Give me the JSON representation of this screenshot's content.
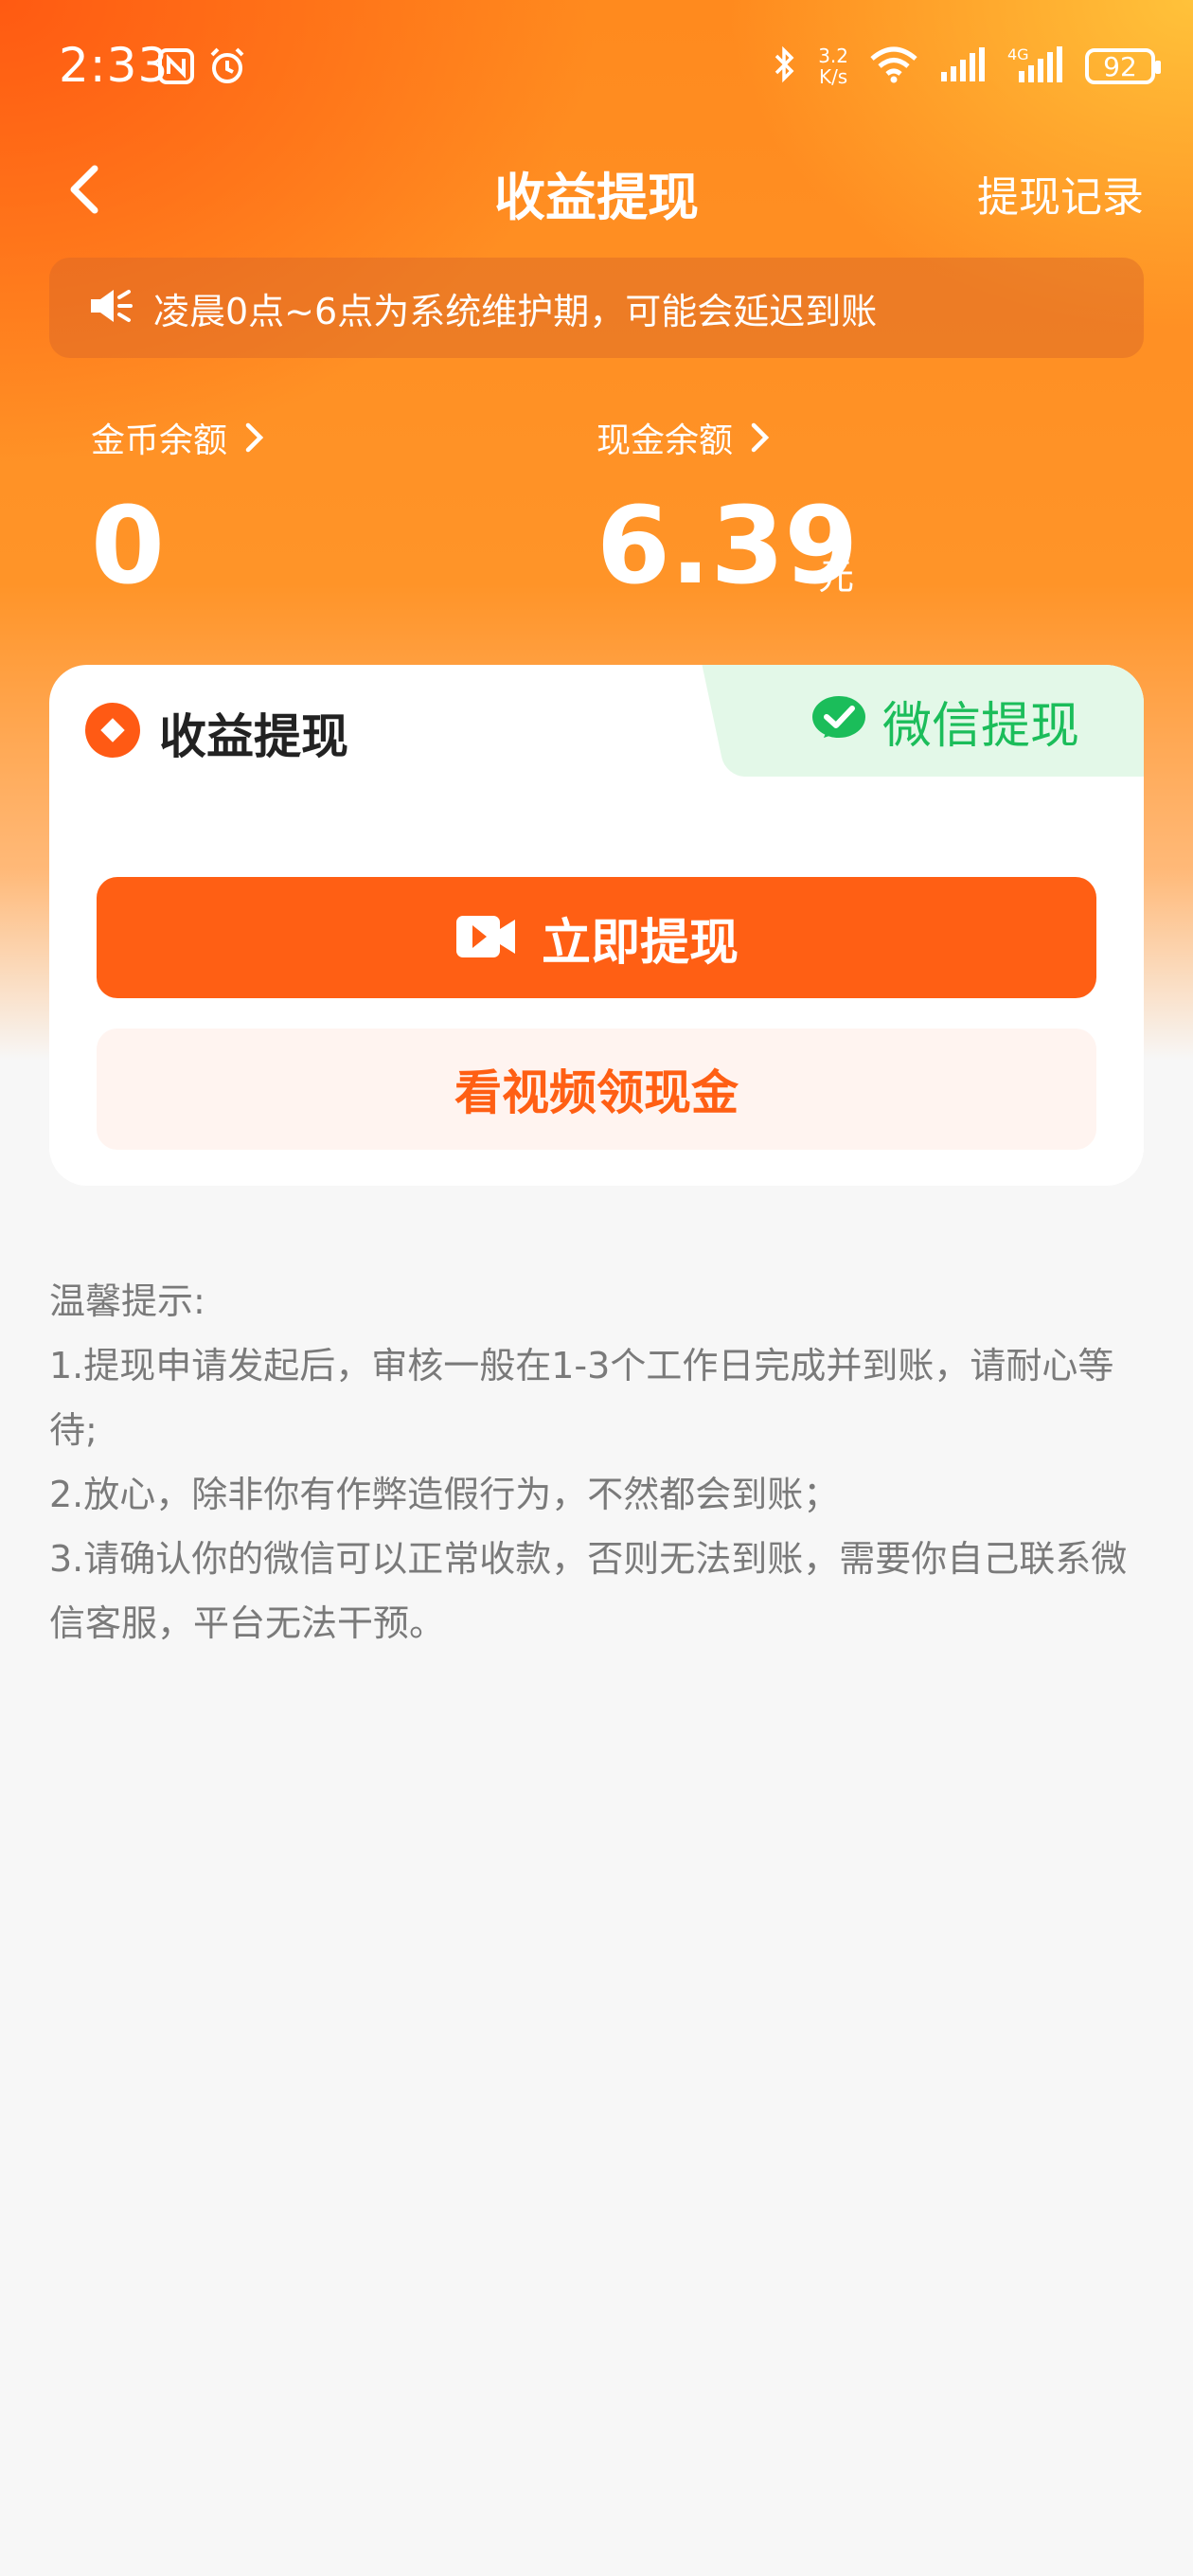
{
  "status_bar": {
    "time": "2:33",
    "net_speed_top": "3.2",
    "net_speed_bottom": "K/s",
    "battery": "92",
    "icons": [
      "nfc-icon",
      "alarm-icon",
      "bluetooth-icon",
      "wifi-icon",
      "signal-icon",
      "signal-4g-icon",
      "battery-icon"
    ]
  },
  "header": {
    "title": "收益提现",
    "right_link": "提现记录"
  },
  "notice": {
    "text": "凌晨0点~6点为系统维护期，可能会延迟到账"
  },
  "balances": {
    "coin_label": "金币余额",
    "coin_value": "0",
    "cash_label": "现金余额",
    "cash_value": "6.39",
    "cash_unit": "元"
  },
  "card": {
    "title": "收益提现",
    "wechat_tab": "微信提现",
    "primary_button": "立即提现",
    "secondary_button": "看视频领现金"
  },
  "tips": {
    "heading": "温馨提示:",
    "line1": "1.提现申请发起后，审核一般在1-3个工作日完成并到账，请耐心等待;",
    "line2": "2.放心，除非你有作弊造假行为，不然都会到账；",
    "line3": "3.请确认你的微信可以正常收款，否则无法到账，需要你自己联系微信客服，平台无法干预。"
  },
  "colors": {
    "accent": "#ff5f14",
    "wechat_green": "#1bbd5a",
    "background": "#f7f7f7"
  }
}
